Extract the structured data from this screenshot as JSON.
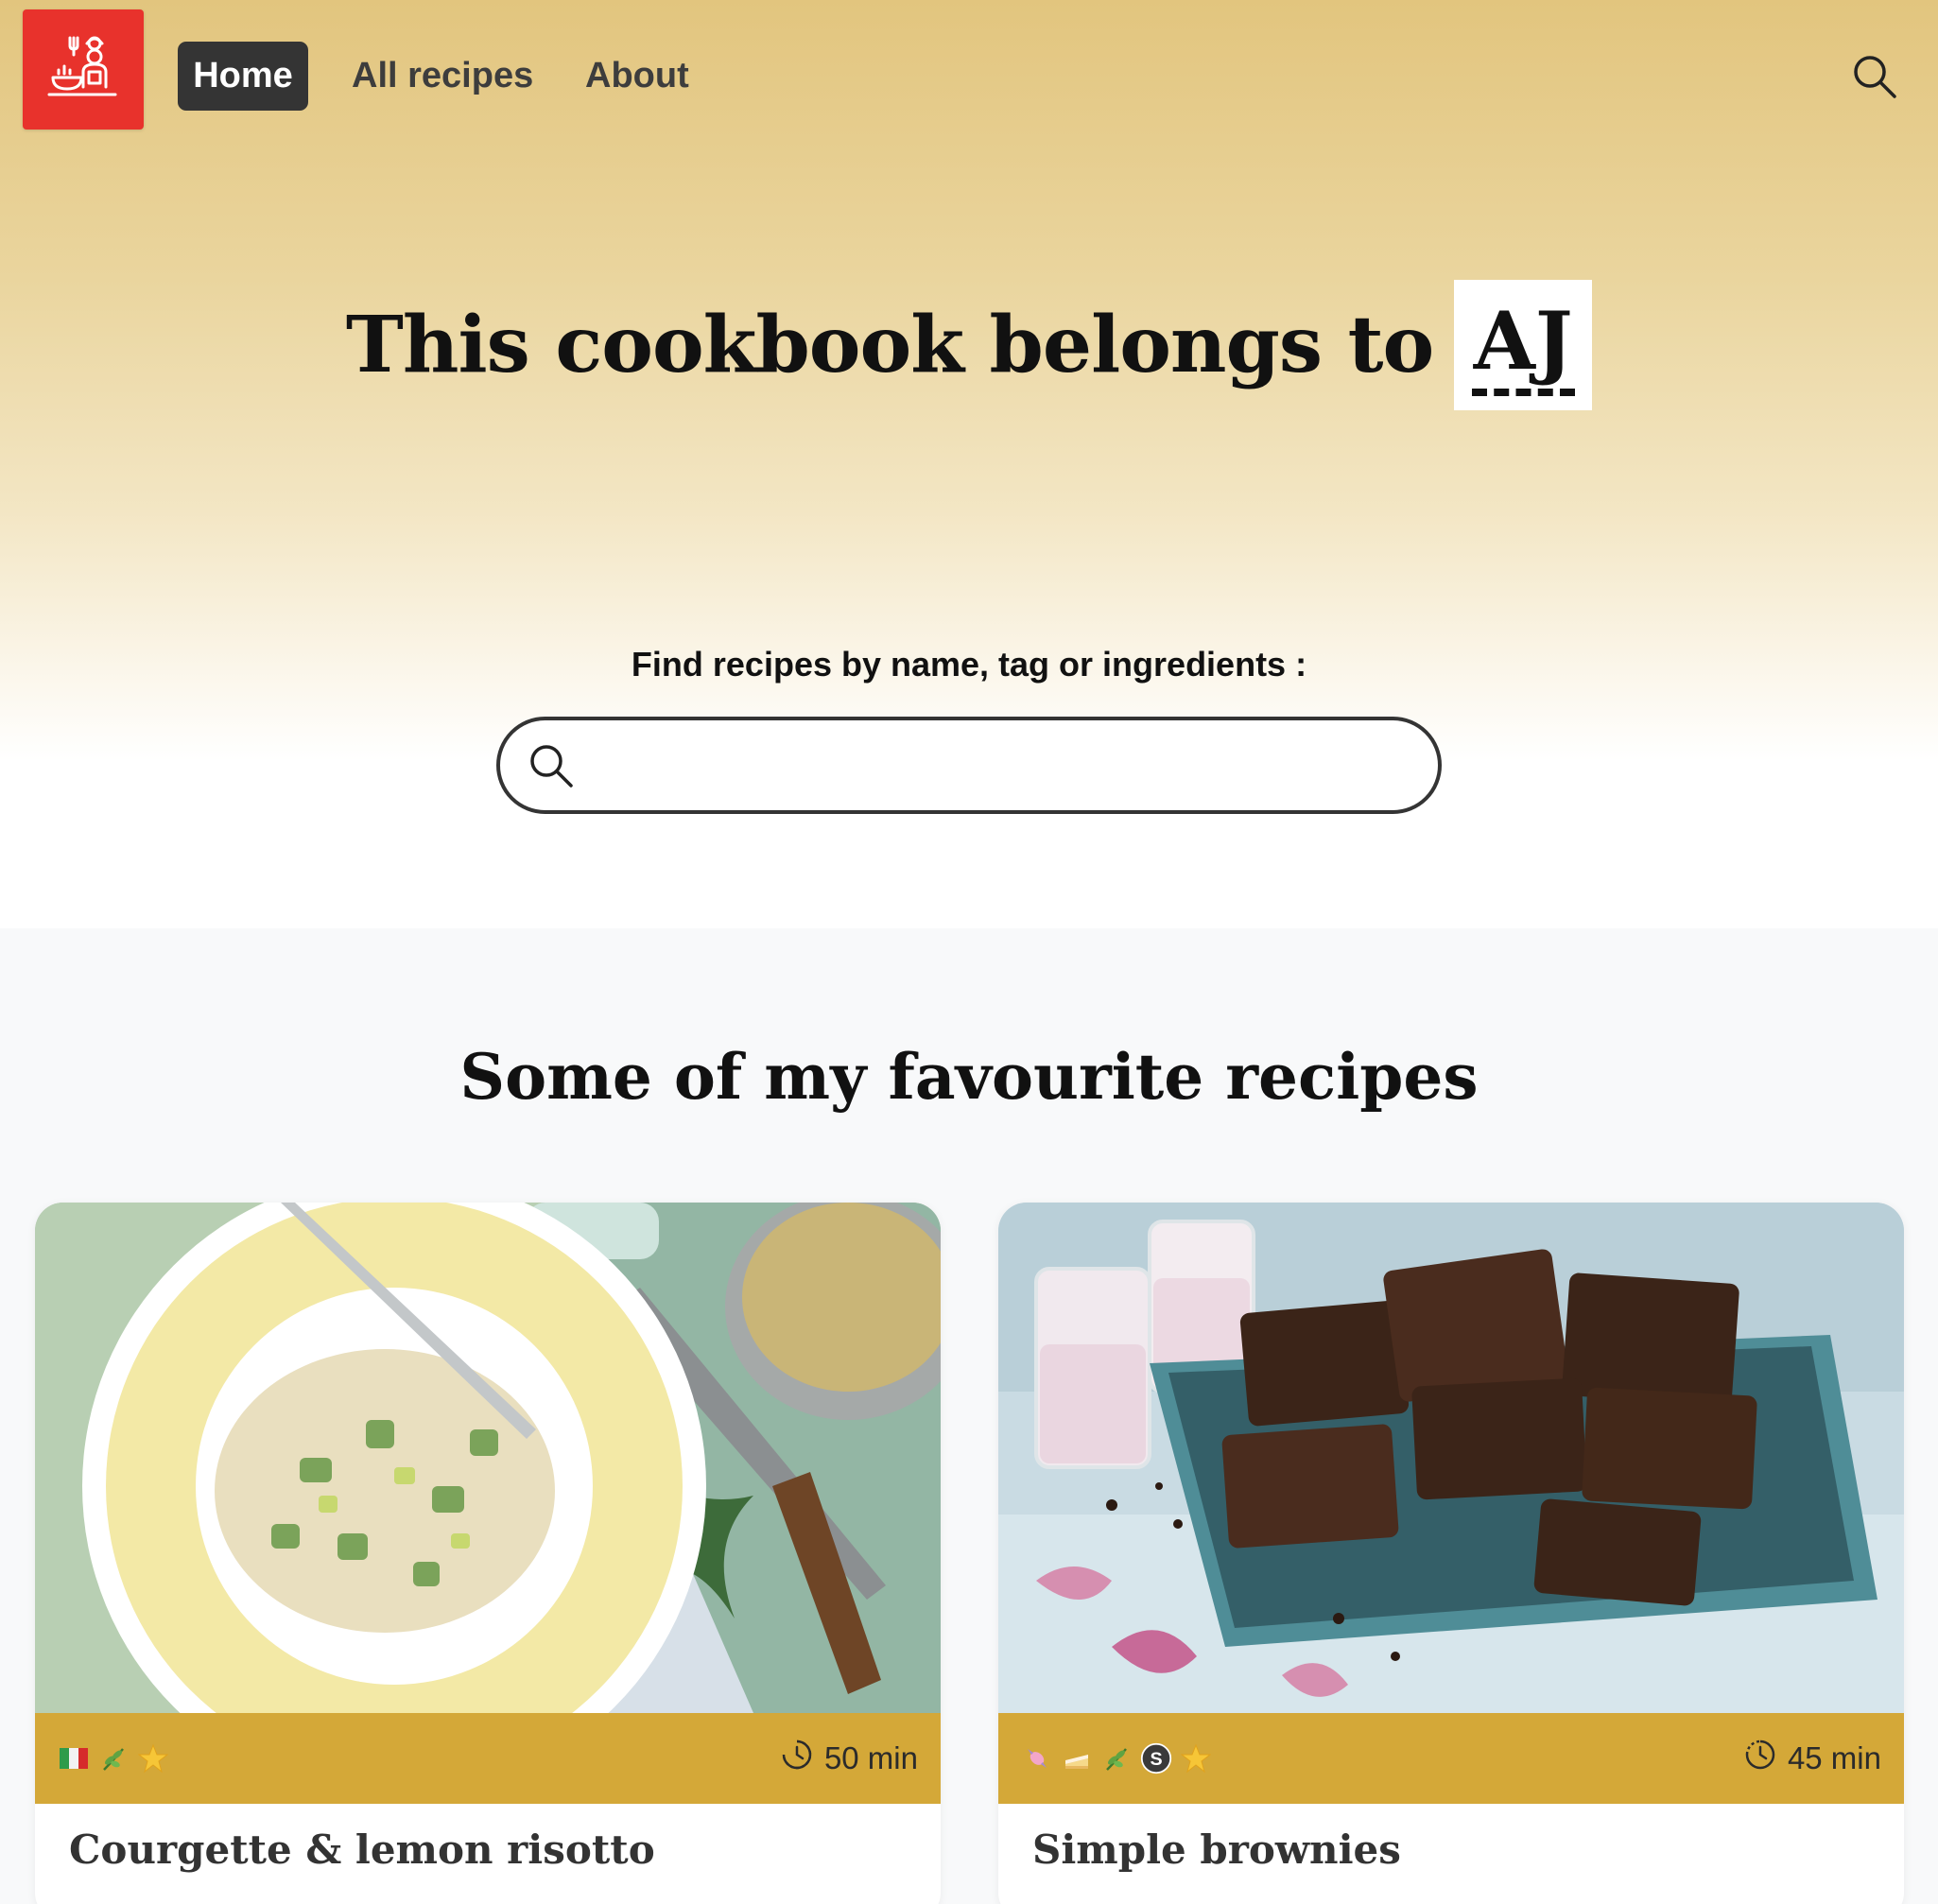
{
  "nav": {
    "home": "Home",
    "all_recipes": "All recipes",
    "about": "About"
  },
  "hero": {
    "title": "This cookbook belongs to",
    "owner": "AJ"
  },
  "search": {
    "label": "Find recipes by name, tag or ingredients :",
    "value": "",
    "placeholder": ""
  },
  "favourites": {
    "title": "Some of my favourite recipes",
    "recipes": [
      {
        "name": "Courgette & lemon risotto",
        "time": "50 min",
        "tags": [
          "italy-flag-icon",
          "herb-icon",
          "star-icon"
        ]
      },
      {
        "name": "Simple brownies",
        "time": "45 min",
        "tags": [
          "candy-icon",
          "cake-icon",
          "herb-icon",
          "s-badge-icon",
          "star-icon"
        ]
      }
    ]
  },
  "colors": {
    "logo_bg": "#e8322c",
    "nav_active_bg": "#343434",
    "card_meta_bg": "#d4a838",
    "hero_gradient_top": "#e2c57e"
  }
}
